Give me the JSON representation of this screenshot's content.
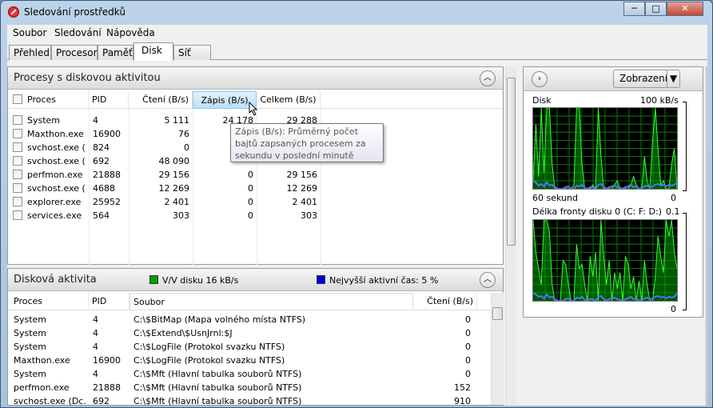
{
  "window": {
    "title": "Sledování prostředků",
    "min": "─",
    "max": "□",
    "close": "✕"
  },
  "menu": [
    "Soubor",
    "Sledování",
    "Nápověda"
  ],
  "tabs": [
    {
      "label": "Přehled"
    },
    {
      "label": "Procesor"
    },
    {
      "label": "Paměť"
    },
    {
      "label": "Disk",
      "active": true
    },
    {
      "label": "Síť"
    }
  ],
  "processes": {
    "title": "Procesy s diskovou aktivitou",
    "columns": [
      "Proces",
      "PID",
      "Čtení (B/s)",
      "Zápis (B/s)",
      "Celkem (B/s)"
    ],
    "rows": [
      [
        "System",
        "4",
        "5 111",
        "24 178",
        "29 288"
      ],
      [
        "Maxthon.exe",
        "16900",
        "76",
        "",
        ""
      ],
      [
        "svchost.exe (...",
        "824",
        "0",
        "",
        ""
      ],
      [
        "svchost.exe (...",
        "692",
        "48 090",
        "",
        ""
      ],
      [
        "perfmon.exe",
        "21888",
        "29 156",
        "0",
        "29 156"
      ],
      [
        "svchost.exe (...",
        "4688",
        "12 269",
        "0",
        "12 269"
      ],
      [
        "explorer.exe",
        "25952",
        "2 401",
        "0",
        "2 401"
      ],
      [
        "services.exe",
        "564",
        "303",
        "0",
        "303"
      ]
    ],
    "tooltip": "Zápis (B/s): Průměrný počet bajtů zapsaných procesem za sekundu v poslední minutě"
  },
  "activity": {
    "title": "Disková aktivita",
    "io_legend": "V/V disku 16 kB/s",
    "active_legend": "Nejvyšší aktivní čas: 5 %",
    "io_color": "#00cc00",
    "active_color": "#0000e0",
    "columns": [
      "Proces",
      "PID",
      "Soubor",
      "Čtení (B/s)"
    ],
    "rows": [
      [
        "System",
        "4",
        "C:\\$BitMap (Mapa volného místa NTFS)",
        "0"
      ],
      [
        "System",
        "4",
        "C:\\$Extend\\$UsnJrnl:$J",
        "0"
      ],
      [
        "System",
        "4",
        "C:\\$LogFile (Protokol svazku NTFS)",
        "0"
      ],
      [
        "Maxthon.exe",
        "16900",
        "C:\\$LogFile (Protokol svazku NTFS)",
        "0"
      ],
      [
        "System",
        "4",
        "C:\\$Mft (Hlavní tabulka souborů NTFS)",
        "0"
      ],
      [
        "perfmon.exe",
        "21888",
        "C:\\$Mft (Hlavní tabulka souborů NTFS)",
        "152"
      ],
      [
        "svchost.exe (Dc...",
        "692",
        "C:\\$Mft (Hlavní tabulka souborů NTFS)",
        "910"
      ]
    ]
  },
  "sidepanel": {
    "view_button": "Zobrazení",
    "graph1": {
      "label": "Disk",
      "max": "100 kB/s",
      "time": "60 sekund",
      "min": "0",
      "green": [
        10,
        80,
        15,
        100,
        20,
        100,
        100,
        30,
        0,
        0,
        0,
        0,
        0,
        0,
        0,
        5,
        100,
        100,
        30,
        0,
        0,
        0,
        5,
        0,
        100,
        40,
        0,
        0,
        0,
        0,
        5,
        10,
        0,
        0,
        0,
        0,
        5,
        15,
        5,
        0,
        0,
        40,
        10,
        0,
        60,
        100,
        50,
        5,
        10,
        0,
        0,
        30,
        50,
        0
      ],
      "blue": [
        10,
        8,
        4,
        6,
        3,
        8,
        4,
        5,
        2,
        0,
        0,
        0,
        2,
        3,
        0,
        0,
        4,
        3,
        5,
        1,
        0,
        2,
        2,
        0,
        5,
        6,
        2,
        0,
        2,
        3,
        4,
        2,
        1,
        0,
        2,
        3,
        5,
        2,
        3,
        0,
        1,
        3,
        4,
        2,
        3,
        5,
        6,
        4,
        5,
        3,
        5,
        4,
        5,
        8
      ]
    },
    "graph2": {
      "label": "Délka fronty disku 0 (C: F: D:)",
      "max": "0.1",
      "min": "0",
      "green": [
        100,
        60,
        40,
        20,
        100,
        100,
        85,
        20,
        0,
        0,
        0,
        50,
        45,
        20,
        0,
        0,
        70,
        40,
        45,
        20,
        0,
        55,
        30,
        60,
        0,
        100,
        55,
        20,
        50,
        0,
        35,
        15,
        35,
        0,
        55,
        45,
        15,
        30,
        0,
        25,
        0,
        50,
        20,
        0,
        0,
        30,
        80,
        55,
        35,
        100,
        80,
        100,
        60,
        40
      ],
      "blue": [
        10,
        8,
        5,
        6,
        3,
        8,
        4,
        5,
        2,
        0,
        0,
        0,
        2,
        3,
        0,
        0,
        4,
        3,
        5,
        1,
        0,
        2,
        2,
        0,
        5,
        6,
        2,
        0,
        2,
        3,
        4,
        2,
        1,
        0,
        2,
        3,
        5,
        2,
        3,
        0,
        1,
        3,
        4,
        2,
        3,
        5,
        6,
        4,
        5,
        3,
        5,
        4,
        5,
        9
      ]
    }
  }
}
